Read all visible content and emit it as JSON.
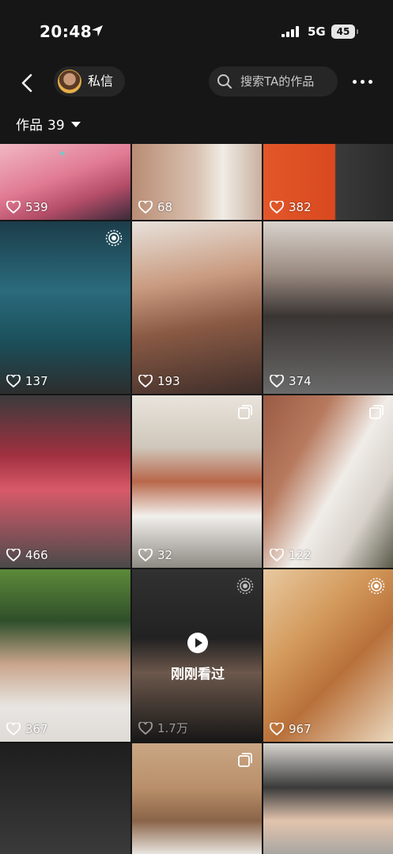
{
  "status_bar": {
    "time": "20:48",
    "network": "5G",
    "battery": "45"
  },
  "nav": {
    "dm_label": "私信",
    "search_placeholder": "搜索TA的作品"
  },
  "works": {
    "label": "作品",
    "count": "39"
  },
  "colors": {
    "background": "#161616",
    "pill": "#262626",
    "accent_star": "#3fe0d8"
  },
  "tiles": [
    {
      "likes": "539",
      "badge": null
    },
    {
      "likes": "68",
      "badge": null
    },
    {
      "likes": "382",
      "badge": null
    },
    {
      "likes": "137",
      "badge": "live-photo-icon"
    },
    {
      "likes": "193",
      "badge": null
    },
    {
      "likes": "374",
      "badge": null
    },
    {
      "likes": "466",
      "badge": null
    },
    {
      "likes": "32",
      "badge": "gallery-icon"
    },
    {
      "likes": "122",
      "badge": "gallery-icon"
    },
    {
      "likes": "367",
      "badge": null
    },
    {
      "likes": "1.7万",
      "badge": "live-photo-icon",
      "overlay_text": "刚刚看过"
    },
    {
      "likes": "967",
      "badge": "live-photo-icon"
    },
    {
      "likes": "",
      "badge": null
    },
    {
      "likes": "",
      "badge": "gallery-icon"
    },
    {
      "likes": "",
      "badge": null
    }
  ]
}
